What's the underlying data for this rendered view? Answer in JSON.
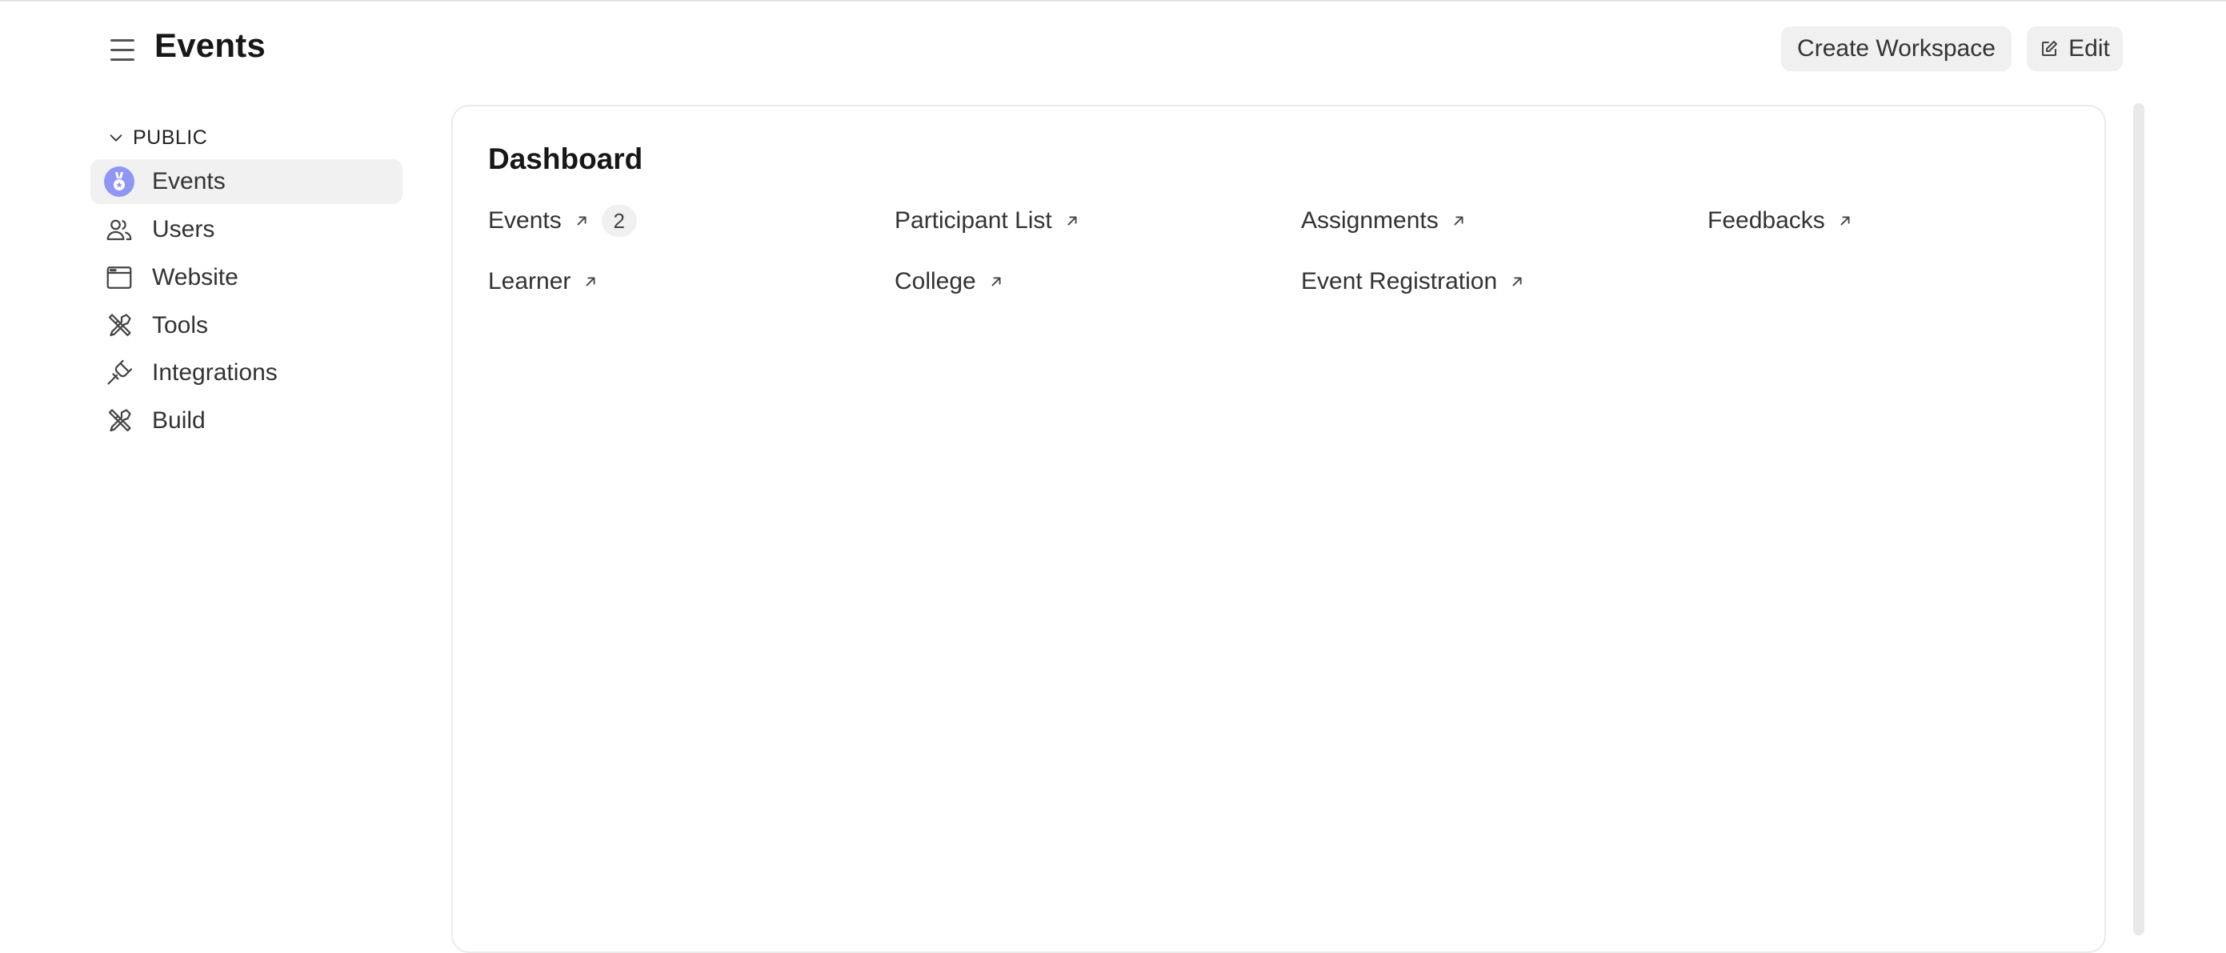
{
  "header": {
    "title": "Events",
    "create_workspace_label": "Create Workspace",
    "edit_label": "Edit"
  },
  "sidebar": {
    "section_label": "PUBLIC",
    "items": [
      {
        "label": "Events",
        "icon": "events-badge-icon",
        "active": true
      },
      {
        "label": "Users",
        "icon": "users-icon"
      },
      {
        "label": "Website",
        "icon": "browser-window-icon"
      },
      {
        "label": "Tools",
        "icon": "tools-icon"
      },
      {
        "label": "Integrations",
        "icon": "plug-icon"
      },
      {
        "label": "Build",
        "icon": "build-tools-icon"
      }
    ]
  },
  "dashboard": {
    "title": "Dashboard",
    "shortcuts": [
      {
        "label": "Events",
        "count": "2"
      },
      {
        "label": "Participant List"
      },
      {
        "label": "Assignments"
      },
      {
        "label": "Feedbacks"
      },
      {
        "label": "Learner"
      },
      {
        "label": "College"
      },
      {
        "label": "Event Registration"
      }
    ]
  },
  "colors": {
    "accent_icon": "#7b82f0",
    "active_bg": "#f1f1f1",
    "button_bg": "#f0f0f0",
    "text": "#333333"
  }
}
